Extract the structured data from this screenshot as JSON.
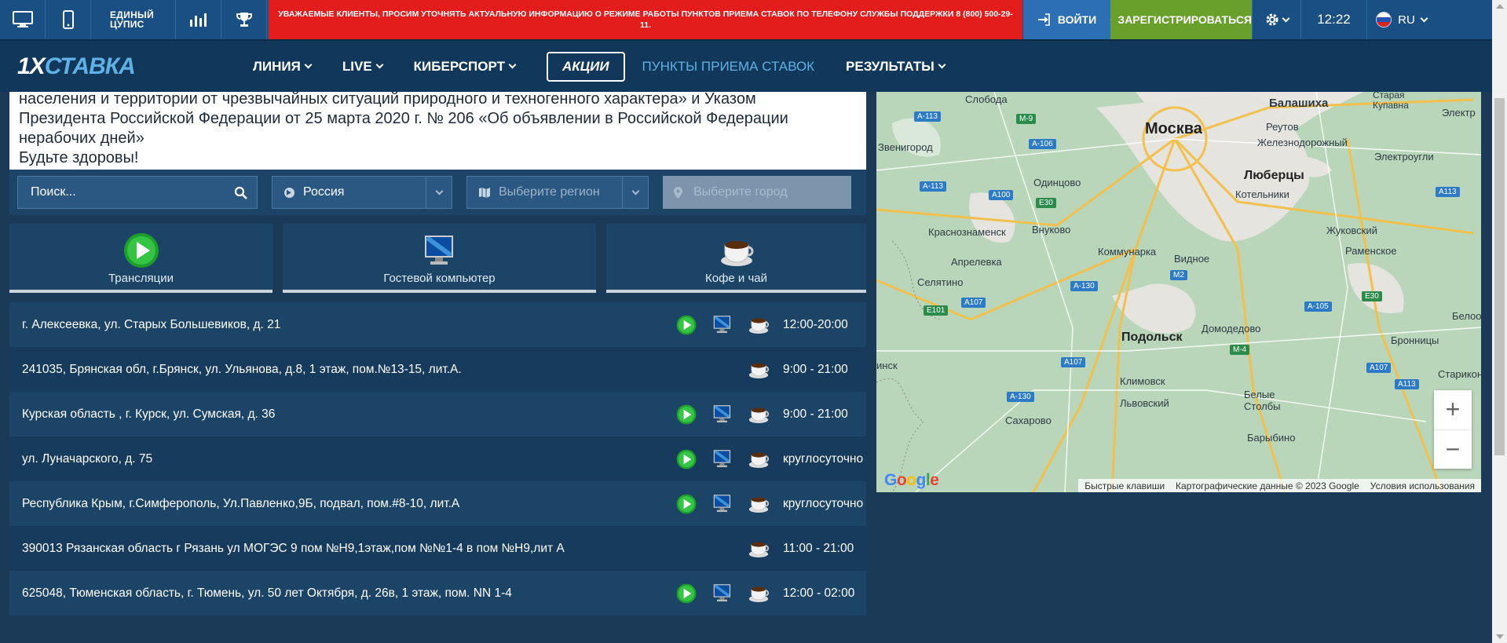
{
  "topbar": {
    "cupis_line1": "ЕДИНЫЙ",
    "cupis_line2": "ЦУПИС",
    "notice": "УВАЖАЕМЫЕ КЛИЕНТЫ, ПРОСИМ УТОЧНЯТЬ АКТУАЛЬНУЮ ИНФОРМАЦИЮ О РЕЖИМЕ РАБОТЫ ПУНКТОВ ПРИЕМА СТАВОК ПО ТЕЛЕФОНУ СЛУЖБЫ ПОДДЕРЖКИ 8 (800) 500-29-11.",
    "login_label": "ВОЙТИ",
    "register_label": "ЗАРЕГИСТРИРОВАТЬСЯ",
    "time": "12:22",
    "language": "RU"
  },
  "nav": {
    "logo_prefix": "1X",
    "logo_suffix": "СТАВКА",
    "items": [
      "ЛИНИЯ",
      "LIVE",
      "КИБЕРСПОРТ"
    ],
    "promo": "АКЦИИ",
    "points": "ПУНКТЫ ПРИЕМА СТАВОК",
    "results": "РЕЗУЛЬТАТЫ"
  },
  "notice_text": {
    "line1": "населения и территории от чрезвычайных ситуаций природного и техногенного характера» и Указом",
    "line2": "Президента Российской Федерации от 25 марта 2020 г. № 206 «Об объявлении в Российской Федерации",
    "line3": "нерабочих дней»",
    "line4": "Будьте здоровы!"
  },
  "filters": {
    "search_placeholder": "Поиск...",
    "country": "Россия",
    "region_placeholder": "Выберите регион",
    "city_placeholder": "Выберите город"
  },
  "services": [
    "Трансляции",
    "Гостевой компьютер",
    "Кофе и чай"
  ],
  "points": [
    {
      "address": "г. Алексеевка, ул. Старых Большевиков, д. 21",
      "stream": true,
      "computer": true,
      "coffee": true,
      "hours": "12:00-20:00"
    },
    {
      "address": "241035, Брянская обл, г.Брянск, ул. Ульянова, д.8, 1 этаж, пом.№13-15, лит.А.",
      "stream": false,
      "computer": false,
      "coffee": true,
      "hours": "9:00 - 21:00"
    },
    {
      "address": "Курская область , г. Курск, ул. Сумская, д. 36",
      "stream": true,
      "computer": true,
      "coffee": true,
      "hours": "9:00 - 21:00"
    },
    {
      "address": "ул. Луначарского, д. 75",
      "stream": true,
      "computer": true,
      "coffee": true,
      "hours": "круглосуточно"
    },
    {
      "address": "Республика Крым, г.Симферополь, Ул.Павленко,9Б, подвал, пом.#8-10, лит.А",
      "stream": true,
      "computer": true,
      "coffee": true,
      "hours": "круглосуточно"
    },
    {
      "address": "390013 Рязанская область г Рязань ул МОГЭС 9 пом №Н9,1этаж,пом №№1-4 в пом №Н9,лит А",
      "stream": false,
      "computer": false,
      "coffee": true,
      "hours": "11:00 - 21:00"
    },
    {
      "address": "625048, Тюменская область, г. Тюмень, ул. 50 лет Октября, д. 26в, 1 этаж, пом. NN 1-4",
      "stream": true,
      "computer": true,
      "coffee": true,
      "hours": "12:00 - 02:00"
    }
  ],
  "map": {
    "cities_big": [
      "Москва"
    ],
    "cities_mid": [
      "Люберцы",
      "Подольск"
    ],
    "places": [
      "Слобода",
      "Балашиха",
      "Старая Купавна",
      "Электр",
      "Звенигород",
      "Реутов",
      "Железнодорожный",
      "Электроугли",
      "Одинцово",
      "Котельники",
      "Краснознаменск",
      "Внуково",
      "Жуковский",
      "Апрелевка",
      "Коммунарка",
      "Видное",
      "Раменское",
      "Селятино",
      "Домодедово",
      "Белоозё",
      "Бронницы",
      "инск",
      "Климовск",
      "Львовский",
      "Белые Столбы",
      "Старикон",
      "Сахарово",
      "Барыбино"
    ],
    "roads": [
      "А-113",
      "М-9",
      "А-106",
      "А-113",
      "А100",
      "Е30",
      "Е101",
      "А107",
      "А-130",
      "М2",
      "М-4",
      "А-105",
      "Е30",
      "А113",
      "А107",
      "А107",
      "А113",
      "А-130"
    ],
    "shortcuts": "Быстрые клавиши",
    "map_data": "Картографические данные © 2023 Google",
    "terms": "Условия использования",
    "google": "Google",
    "zoom_in": "+",
    "zoom_out": "−"
  },
  "colors": {
    "topbar": "#1a4f83",
    "navbar": "#11385b",
    "notice": "#e31c1c",
    "register": "#69a02b",
    "login": "#2d6fb4",
    "accent_link": "#5fb0e5"
  }
}
